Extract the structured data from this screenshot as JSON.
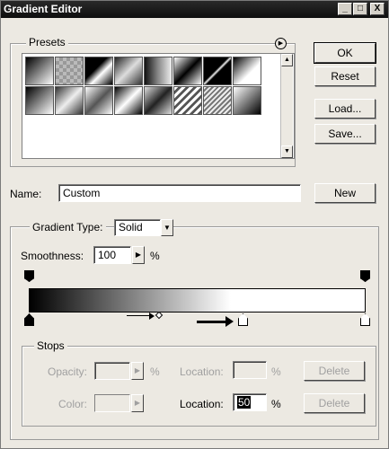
{
  "window": {
    "title": "Gradient Editor",
    "controls": {
      "minimize": "_",
      "maximize": "□",
      "close": "X"
    }
  },
  "presets": {
    "label": "Presets",
    "menu_icon": "circle-arrow-icon"
  },
  "buttons": {
    "ok": "OK",
    "reset": "Reset",
    "load": "Load...",
    "save": "Save...",
    "new": "New"
  },
  "name": {
    "label": "Name:",
    "value": "Custom"
  },
  "gradient_type": {
    "label": "Gradient Type:",
    "value": "Solid"
  },
  "smoothness": {
    "label": "Smoothness:",
    "value": "100",
    "unit": "%"
  },
  "stops": {
    "label": "Stops",
    "opacity_label": "Opacity:",
    "opacity_value": "",
    "opacity_unit": "%",
    "opacity_location_label": "Location:",
    "opacity_location_value": "",
    "opacity_location_unit": "%",
    "opacity_delete": "Delete",
    "color_label": "Color:",
    "color_location_label": "Location:",
    "color_location_value": "50",
    "color_location_unit": "%",
    "color_delete": "Delete"
  },
  "gradient_bar": {
    "start_color": "#000000",
    "end_color": "#ffffff",
    "midpoint_percent": 50,
    "selected_stop": "color-stop-mid"
  }
}
